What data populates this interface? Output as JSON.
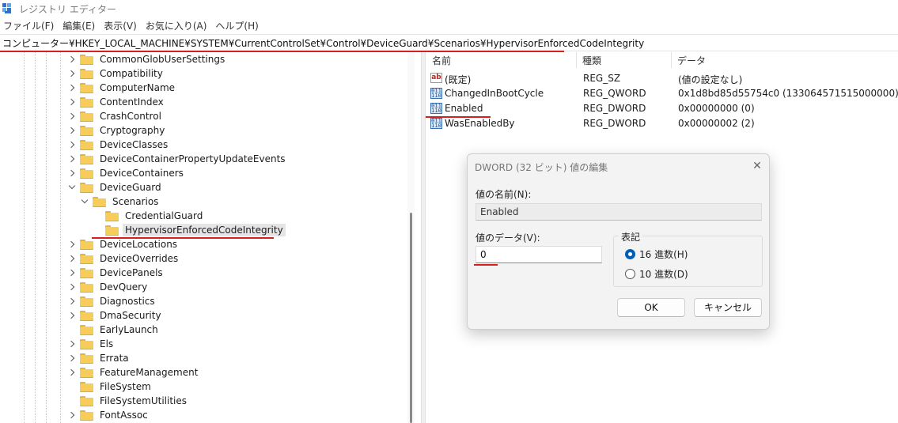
{
  "window": {
    "title": "レジストリ エディター",
    "icon": "registry-editor-icon"
  },
  "menu": [
    "ファイル(F)",
    "編集(E)",
    "表示(V)",
    "お気に入り(A)",
    "ヘルプ(H)"
  ],
  "address": {
    "path": "コンピューター¥HKEY_LOCAL_MACHINE¥SYSTEM¥CurrentControlSet¥Control¥DeviceGuard¥Scenarios¥HypervisorEnforcedCodeIntegrity"
  },
  "tree": {
    "items": [
      {
        "label": "CommonGlobUserSettings",
        "expand": "collapsed"
      },
      {
        "label": "Compatibility",
        "expand": "collapsed"
      },
      {
        "label": "ComputerName",
        "expand": "collapsed"
      },
      {
        "label": "ContentIndex",
        "expand": "collapsed"
      },
      {
        "label": "CrashControl",
        "expand": "collapsed"
      },
      {
        "label": "Cryptography",
        "expand": "collapsed"
      },
      {
        "label": "DeviceClasses",
        "expand": "collapsed"
      },
      {
        "label": "DeviceContainerPropertyUpdateEvents",
        "expand": "collapsed"
      },
      {
        "label": "DeviceContainers",
        "expand": "collapsed"
      },
      {
        "label": "DeviceGuard",
        "expand": "expanded"
      },
      {
        "label": "Scenarios",
        "expand": "expanded"
      },
      {
        "label": "CredentialGuard",
        "expand": "none"
      },
      {
        "label": "HypervisorEnforcedCodeIntegrity",
        "expand": "none",
        "selected": true
      },
      {
        "label": "DeviceLocations",
        "expand": "collapsed"
      },
      {
        "label": "DeviceOverrides",
        "expand": "collapsed"
      },
      {
        "label": "DevicePanels",
        "expand": "collapsed"
      },
      {
        "label": "DevQuery",
        "expand": "collapsed"
      },
      {
        "label": "Diagnostics",
        "expand": "collapsed"
      },
      {
        "label": "DmaSecurity",
        "expand": "collapsed"
      },
      {
        "label": "EarlyLaunch",
        "expand": "none"
      },
      {
        "label": "Els",
        "expand": "collapsed"
      },
      {
        "label": "Errata",
        "expand": "collapsed"
      },
      {
        "label": "FeatureManagement",
        "expand": "collapsed"
      },
      {
        "label": "FileSystem",
        "expand": "none"
      },
      {
        "label": "FileSystemUtilities",
        "expand": "none"
      },
      {
        "label": "FontAssoc",
        "expand": "collapsed"
      }
    ]
  },
  "values_list": {
    "columns": [
      "名前",
      "種類",
      "データ"
    ],
    "rows": [
      {
        "icon": "string-value-icon",
        "name": "(既定)",
        "type": "REG_SZ",
        "data": "(値の設定なし)"
      },
      {
        "icon": "binary-value-icon",
        "name": "ChangedInBootCycle",
        "type": "REG_QWORD",
        "data": "0x1d8bd85d55754c0 (133064571515000000)"
      },
      {
        "icon": "binary-value-icon",
        "name": "Enabled",
        "type": "REG_DWORD",
        "data": "0x00000000 (0)"
      },
      {
        "icon": "binary-value-icon",
        "name": "WasEnabledBy",
        "type": "REG_DWORD",
        "data": "0x00000002 (2)"
      }
    ]
  },
  "dialog": {
    "title": "DWORD (32 ビット) 値の編集",
    "close": "✕",
    "name_label": "値の名前(N):",
    "name_value": "Enabled",
    "data_label": "値のデータ(V):",
    "data_value": "0",
    "base_label": "表記",
    "hex_label": "16 進数(H)",
    "dec_label": "10 進数(D)",
    "selected_base": "hex",
    "ok_label": "OK",
    "cancel_label": "キャンセル"
  },
  "annotation_color": "#d62020"
}
